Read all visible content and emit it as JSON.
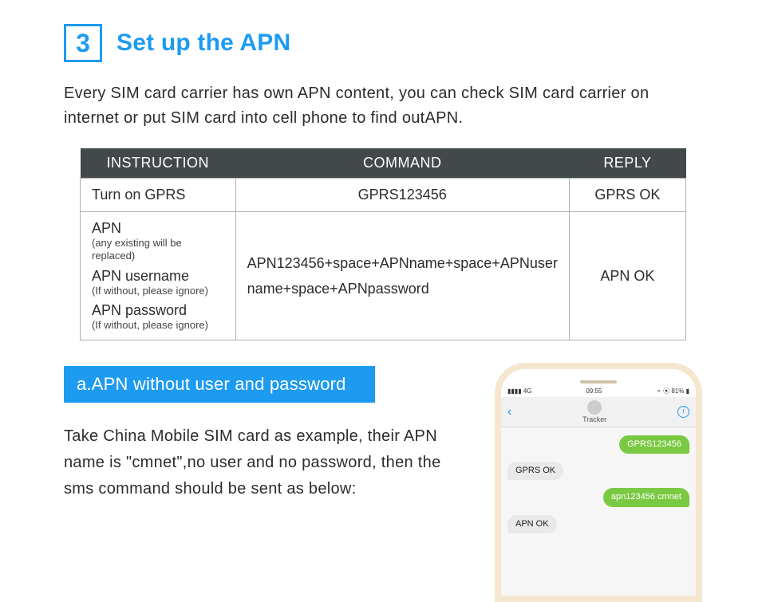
{
  "step": {
    "number": "3",
    "title": "Set up the APN"
  },
  "intro": "Every SIM card carrier has own APN content, you can check SIM card carrier on internet or put SIM card into cell phone to find outAPN.",
  "table": {
    "headers": {
      "h1": "INSTRUCTION",
      "h2": "COMMAND",
      "h3": "REPLY"
    },
    "row1": {
      "instruction": "Turn on GPRS",
      "command": "GPRS123456",
      "reply": "GPRS OK"
    },
    "row2": {
      "apn": {
        "main": "APN",
        "sub": "(any existing will be replaced)"
      },
      "apnUser": {
        "main": "APN username",
        "sub": "(If without, please ignore)"
      },
      "apnPass": {
        "main": "APN password",
        "sub": "(If without, please ignore)"
      },
      "command": "APN123456+space+APNname+space+APNuser name+space+APNpassword",
      "reply": "APN OK"
    }
  },
  "subheadA": "a.APN without user and password",
  "exampleText": "Take China Mobile SIM card as example, their APN name is \"cmnet\",no user and no password, then the sms command should be sent as below:",
  "phone": {
    "status": {
      "left": "4G",
      "time": "09:55",
      "right": "81%"
    },
    "contact": "Tracker",
    "messages": {
      "m1": "GPRS123456",
      "m2": "GPRS OK",
      "m3": "apn123456 cmnet",
      "m4": "APN OK"
    }
  }
}
